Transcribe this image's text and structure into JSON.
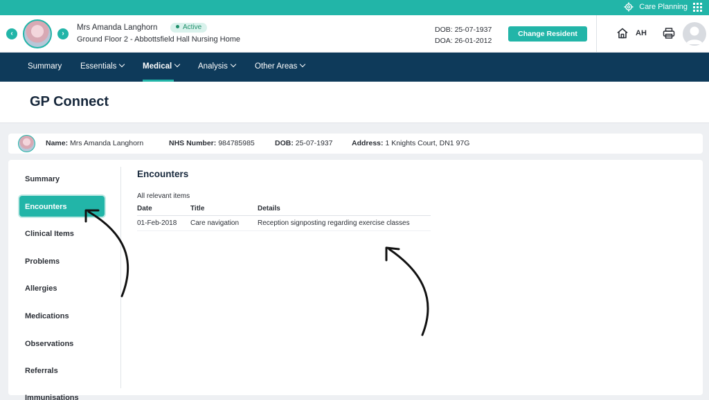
{
  "topbar": {
    "section_label": "Care Planning",
    "icons": [
      "gear-icon",
      "grid-icon"
    ]
  },
  "resident": {
    "name": "Mrs Amanda Langhorn",
    "status": "Active",
    "location": "Ground Floor 2 - Abbottsfield Hall Nursing Home",
    "dob_line": "DOB: 25-07-1937",
    "doa_line": "DOA: 26-01-2012",
    "change_button": "Change Resident",
    "user_initials": "AH"
  },
  "nav": {
    "items": [
      {
        "label": "Summary"
      },
      {
        "label": "Essentials"
      },
      {
        "label": "Medical"
      },
      {
        "label": "Analysis"
      },
      {
        "label": "Other Areas"
      }
    ],
    "active": "Medical"
  },
  "page": {
    "title": "GP Connect"
  },
  "patient_strip": {
    "name_label": "Name:",
    "name_value": "Mrs Amanda Langhorn",
    "nhs_label": "NHS Number:",
    "nhs_value": "984785985",
    "dob_label": "DOB:",
    "dob_value": "25-07-1937",
    "address_label": "Address:",
    "address_value": "1 Knights Court, DN1 97G"
  },
  "side_menu": {
    "items": [
      {
        "label": "Summary"
      },
      {
        "label": "Encounters"
      },
      {
        "label": "Clinical Items"
      },
      {
        "label": "Problems"
      },
      {
        "label": "Allergies"
      },
      {
        "label": "Medications"
      },
      {
        "label": "Observations"
      },
      {
        "label": "Referrals"
      },
      {
        "label": "Immunisations"
      }
    ],
    "active": "Encounters"
  },
  "encounters": {
    "title": "Encounters",
    "subtitle": "All relevant items",
    "columns": [
      "Date",
      "Title",
      "Details"
    ],
    "rows": [
      [
        "01-Feb-2018",
        "Care navigation",
        "Reception signposting regarding exercise classes"
      ]
    ]
  },
  "colors": {
    "accent": "#22b5a8",
    "navbar": "#0e3a5a",
    "status_bg": "#d9f2ec",
    "status_text": "#1f8f6a"
  }
}
